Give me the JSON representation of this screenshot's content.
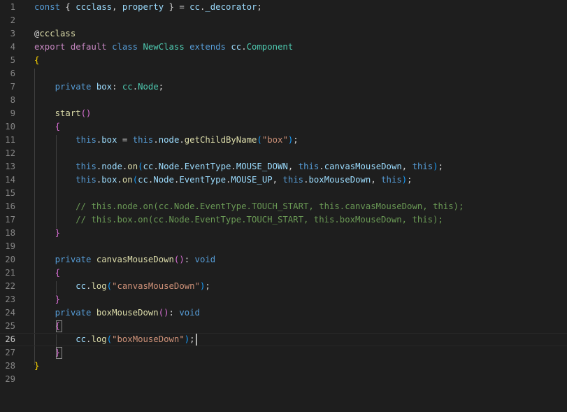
{
  "editor": {
    "line_numbers": [
      "1",
      "2",
      "3",
      "4",
      "5",
      "6",
      "7",
      "8",
      "9",
      "10",
      "11",
      "12",
      "13",
      "14",
      "15",
      "16",
      "17",
      "18",
      "19",
      "20",
      "21",
      "22",
      "23",
      "24",
      "25",
      "26",
      "27",
      "28",
      "29"
    ],
    "active_line": "26",
    "lines": [
      [
        {
          "t": "const",
          "c": "kw"
        },
        {
          "t": " { ",
          "c": "pun"
        },
        {
          "t": "ccclass",
          "c": "var"
        },
        {
          "t": ", ",
          "c": "pun"
        },
        {
          "t": "property",
          "c": "var"
        },
        {
          "t": " } = ",
          "c": "pun"
        },
        {
          "t": "cc",
          "c": "var"
        },
        {
          "t": ".",
          "c": "pun"
        },
        {
          "t": "_decorator",
          "c": "var"
        },
        {
          "t": ";",
          "c": "pun"
        }
      ],
      [],
      [
        {
          "t": "@",
          "c": "pun"
        },
        {
          "t": "ccclass",
          "c": "fn"
        }
      ],
      [
        {
          "t": "export",
          "c": "kw2"
        },
        {
          "t": " ",
          "c": "pun"
        },
        {
          "t": "default",
          "c": "kw2"
        },
        {
          "t": " ",
          "c": "pun"
        },
        {
          "t": "class",
          "c": "kw"
        },
        {
          "t": " ",
          "c": "pun"
        },
        {
          "t": "NewClass",
          "c": "typ"
        },
        {
          "t": " ",
          "c": "pun"
        },
        {
          "t": "extends",
          "c": "kw"
        },
        {
          "t": " ",
          "c": "pun"
        },
        {
          "t": "cc",
          "c": "var"
        },
        {
          "t": ".",
          "c": "pun"
        },
        {
          "t": "Component",
          "c": "typ"
        }
      ],
      [
        {
          "t": "{",
          "c": "b1"
        }
      ],
      [],
      [
        {
          "t": "    ",
          "c": "pun"
        },
        {
          "t": "private",
          "c": "kw"
        },
        {
          "t": " ",
          "c": "pun"
        },
        {
          "t": "box",
          "c": "var"
        },
        {
          "t": ": ",
          "c": "pun"
        },
        {
          "t": "cc",
          "c": "typ"
        },
        {
          "t": ".",
          "c": "pun"
        },
        {
          "t": "Node",
          "c": "typ"
        },
        {
          "t": ";",
          "c": "pun"
        }
      ],
      [],
      [
        {
          "t": "    ",
          "c": "pun"
        },
        {
          "t": "start",
          "c": "fn"
        },
        {
          "t": "()",
          "c": "b2"
        }
      ],
      [
        {
          "t": "    ",
          "c": "pun"
        },
        {
          "t": "{",
          "c": "b2"
        }
      ],
      [
        {
          "t": "        ",
          "c": "pun"
        },
        {
          "t": "this",
          "c": "kw"
        },
        {
          "t": ".",
          "c": "pun"
        },
        {
          "t": "box",
          "c": "var"
        },
        {
          "t": " = ",
          "c": "pun"
        },
        {
          "t": "this",
          "c": "kw"
        },
        {
          "t": ".",
          "c": "pun"
        },
        {
          "t": "node",
          "c": "var"
        },
        {
          "t": ".",
          "c": "pun"
        },
        {
          "t": "getChildByName",
          "c": "fn"
        },
        {
          "t": "(",
          "c": "b3"
        },
        {
          "t": "\"box\"",
          "c": "str"
        },
        {
          "t": ")",
          "c": "b3"
        },
        {
          "t": ";",
          "c": "pun"
        }
      ],
      [],
      [
        {
          "t": "        ",
          "c": "pun"
        },
        {
          "t": "this",
          "c": "kw"
        },
        {
          "t": ".",
          "c": "pun"
        },
        {
          "t": "node",
          "c": "var"
        },
        {
          "t": ".",
          "c": "pun"
        },
        {
          "t": "on",
          "c": "fn"
        },
        {
          "t": "(",
          "c": "b3"
        },
        {
          "t": "cc",
          "c": "var"
        },
        {
          "t": ".",
          "c": "pun"
        },
        {
          "t": "Node",
          "c": "var"
        },
        {
          "t": ".",
          "c": "pun"
        },
        {
          "t": "EventType",
          "c": "var"
        },
        {
          "t": ".",
          "c": "pun"
        },
        {
          "t": "MOUSE_DOWN",
          "c": "var"
        },
        {
          "t": ", ",
          "c": "pun"
        },
        {
          "t": "this",
          "c": "kw"
        },
        {
          "t": ".",
          "c": "pun"
        },
        {
          "t": "canvasMouseDown",
          "c": "var"
        },
        {
          "t": ", ",
          "c": "pun"
        },
        {
          "t": "this",
          "c": "kw"
        },
        {
          "t": ")",
          "c": "b3"
        },
        {
          "t": ";",
          "c": "pun"
        }
      ],
      [
        {
          "t": "        ",
          "c": "pun"
        },
        {
          "t": "this",
          "c": "kw"
        },
        {
          "t": ".",
          "c": "pun"
        },
        {
          "t": "box",
          "c": "var"
        },
        {
          "t": ".",
          "c": "pun"
        },
        {
          "t": "on",
          "c": "fn"
        },
        {
          "t": "(",
          "c": "b3"
        },
        {
          "t": "cc",
          "c": "var"
        },
        {
          "t": ".",
          "c": "pun"
        },
        {
          "t": "Node",
          "c": "var"
        },
        {
          "t": ".",
          "c": "pun"
        },
        {
          "t": "EventType",
          "c": "var"
        },
        {
          "t": ".",
          "c": "pun"
        },
        {
          "t": "MOUSE_UP",
          "c": "var"
        },
        {
          "t": ", ",
          "c": "pun"
        },
        {
          "t": "this",
          "c": "kw"
        },
        {
          "t": ".",
          "c": "pun"
        },
        {
          "t": "boxMouseDown",
          "c": "var"
        },
        {
          "t": ", ",
          "c": "pun"
        },
        {
          "t": "this",
          "c": "kw"
        },
        {
          "t": ")",
          "c": "b3"
        },
        {
          "t": ";",
          "c": "pun"
        }
      ],
      [],
      [
        {
          "t": "        ",
          "c": "pun"
        },
        {
          "t": "// this.node.on(cc.Node.EventType.TOUCH_START, this.canvasMouseDown, this);",
          "c": "cmt"
        }
      ],
      [
        {
          "t": "        ",
          "c": "pun"
        },
        {
          "t": "// this.box.on(cc.Node.EventType.TOUCH_START, this.boxMouseDown, this);",
          "c": "cmt"
        }
      ],
      [
        {
          "t": "    ",
          "c": "pun"
        },
        {
          "t": "}",
          "c": "b2"
        }
      ],
      [],
      [
        {
          "t": "    ",
          "c": "pun"
        },
        {
          "t": "private",
          "c": "kw"
        },
        {
          "t": " ",
          "c": "pun"
        },
        {
          "t": "canvasMouseDown",
          "c": "fn"
        },
        {
          "t": "()",
          "c": "b2"
        },
        {
          "t": ": ",
          "c": "pun"
        },
        {
          "t": "void",
          "c": "kw"
        }
      ],
      [
        {
          "t": "    ",
          "c": "pun"
        },
        {
          "t": "{",
          "c": "b2"
        }
      ],
      [
        {
          "t": "        ",
          "c": "pun"
        },
        {
          "t": "cc",
          "c": "var"
        },
        {
          "t": ".",
          "c": "pun"
        },
        {
          "t": "log",
          "c": "fn"
        },
        {
          "t": "(",
          "c": "b3"
        },
        {
          "t": "\"canvasMouseDown\"",
          "c": "str"
        },
        {
          "t": ")",
          "c": "b3"
        },
        {
          "t": ";",
          "c": "pun"
        }
      ],
      [
        {
          "t": "    ",
          "c": "pun"
        },
        {
          "t": "}",
          "c": "b2"
        }
      ],
      [
        {
          "t": "    ",
          "c": "pun"
        },
        {
          "t": "private",
          "c": "kw"
        },
        {
          "t": " ",
          "c": "pun"
        },
        {
          "t": "boxMouseDown",
          "c": "fn"
        },
        {
          "t": "()",
          "c": "b2"
        },
        {
          "t": ": ",
          "c": "pun"
        },
        {
          "t": "void",
          "c": "kw"
        }
      ],
      [
        {
          "t": "    ",
          "c": "pun"
        },
        {
          "t": "{",
          "c": "b2"
        }
      ],
      [
        {
          "t": "        ",
          "c": "pun"
        },
        {
          "t": "cc",
          "c": "var"
        },
        {
          "t": ".",
          "c": "pun"
        },
        {
          "t": "log",
          "c": "fn"
        },
        {
          "t": "(",
          "c": "b3"
        },
        {
          "t": "\"boxMouseDown\"",
          "c": "str"
        },
        {
          "t": ")",
          "c": "b3"
        },
        {
          "t": ";",
          "c": "pun"
        }
      ],
      [
        {
          "t": "    ",
          "c": "pun"
        },
        {
          "t": "}",
          "c": "b2"
        }
      ],
      [
        {
          "t": "}",
          "c": "b1"
        }
      ],
      []
    ]
  },
  "colors": {
    "background": "#1e1e1e",
    "keyword": "#569cd6",
    "control_keyword": "#c586c0",
    "variable": "#9cdcfe",
    "type": "#4ec9b0",
    "function": "#dcdcaa",
    "string": "#ce9178",
    "comment": "#6a9955",
    "bracket_level1": "#ffd700",
    "bracket_level2": "#da70d6",
    "bracket_level3": "#179fff"
  }
}
